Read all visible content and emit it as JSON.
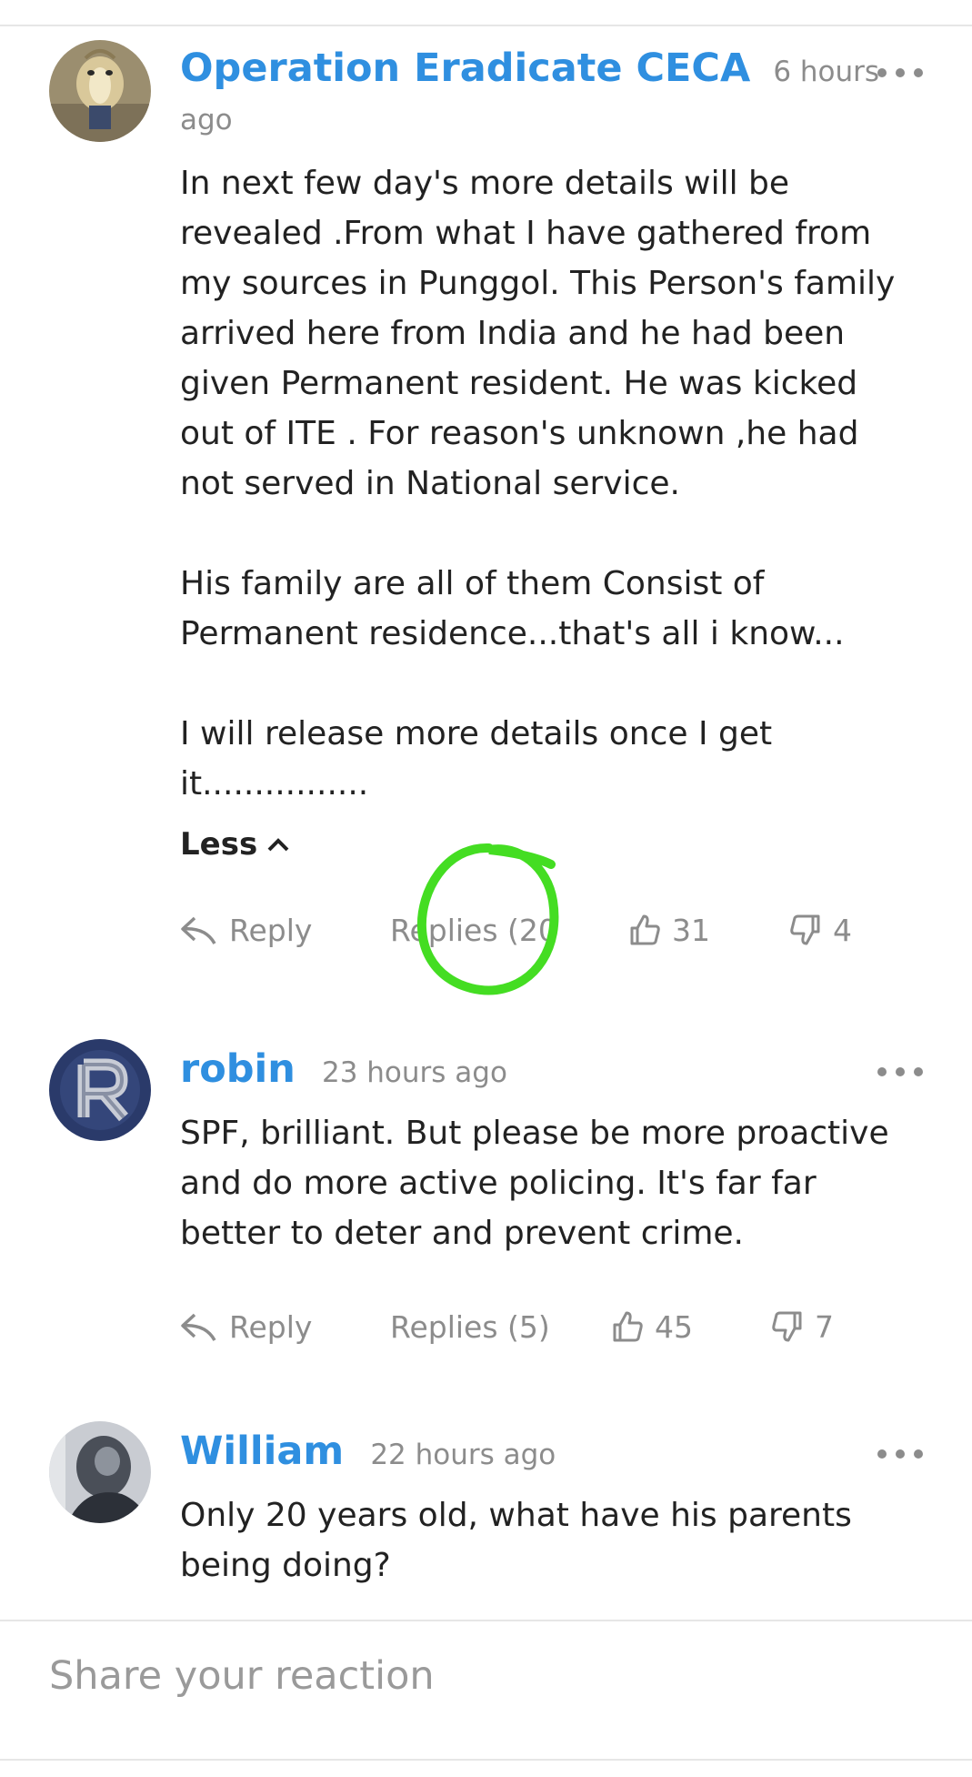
{
  "comments": [
    {
      "author": "Operation Eradicate CECA",
      "time_line1": "6 hours",
      "time_line2": "ago",
      "text": "In next few day's more details will be\nrevealed .From what I have gathered from\nmy sources in Punggol. This Person's family\narrived here from India and he had been\ngiven Permanent resident. He was kicked\nout of ITE . For reason's unknown ,he had\nnot served in National service.\n\nHis family are all of them Consist of\nPermanent residence...that's all i know...\n\nI will release more details once I get\nit................",
      "toggle_label": "Less",
      "reply_label": "Reply",
      "replies_label": "Replies (20",
      "likes": "31",
      "dislikes": "4"
    },
    {
      "author": "robin",
      "time": "23 hours ago",
      "text": "SPF, brilliant. But please be more proactive\nand do more active policing. It's far far\nbetter to deter and prevent crime.",
      "reply_label": "Reply",
      "replies_label": "Replies (5)",
      "likes": "45",
      "dislikes": "7"
    },
    {
      "author": "William",
      "time": "22 hours ago",
      "text": "Only 20 years old, what have his parents\nbeing doing?"
    }
  ],
  "reaction": {
    "placeholder": "Share your reaction"
  },
  "colors": {
    "author": "#2f8fe0",
    "meta": "#8c8c8c",
    "annotation": "#44dd22"
  },
  "icons": [
    "more-options-icon",
    "reply-arrow-icon",
    "thumbs-up-icon",
    "thumbs-down-icon",
    "chevron-up-icon"
  ]
}
